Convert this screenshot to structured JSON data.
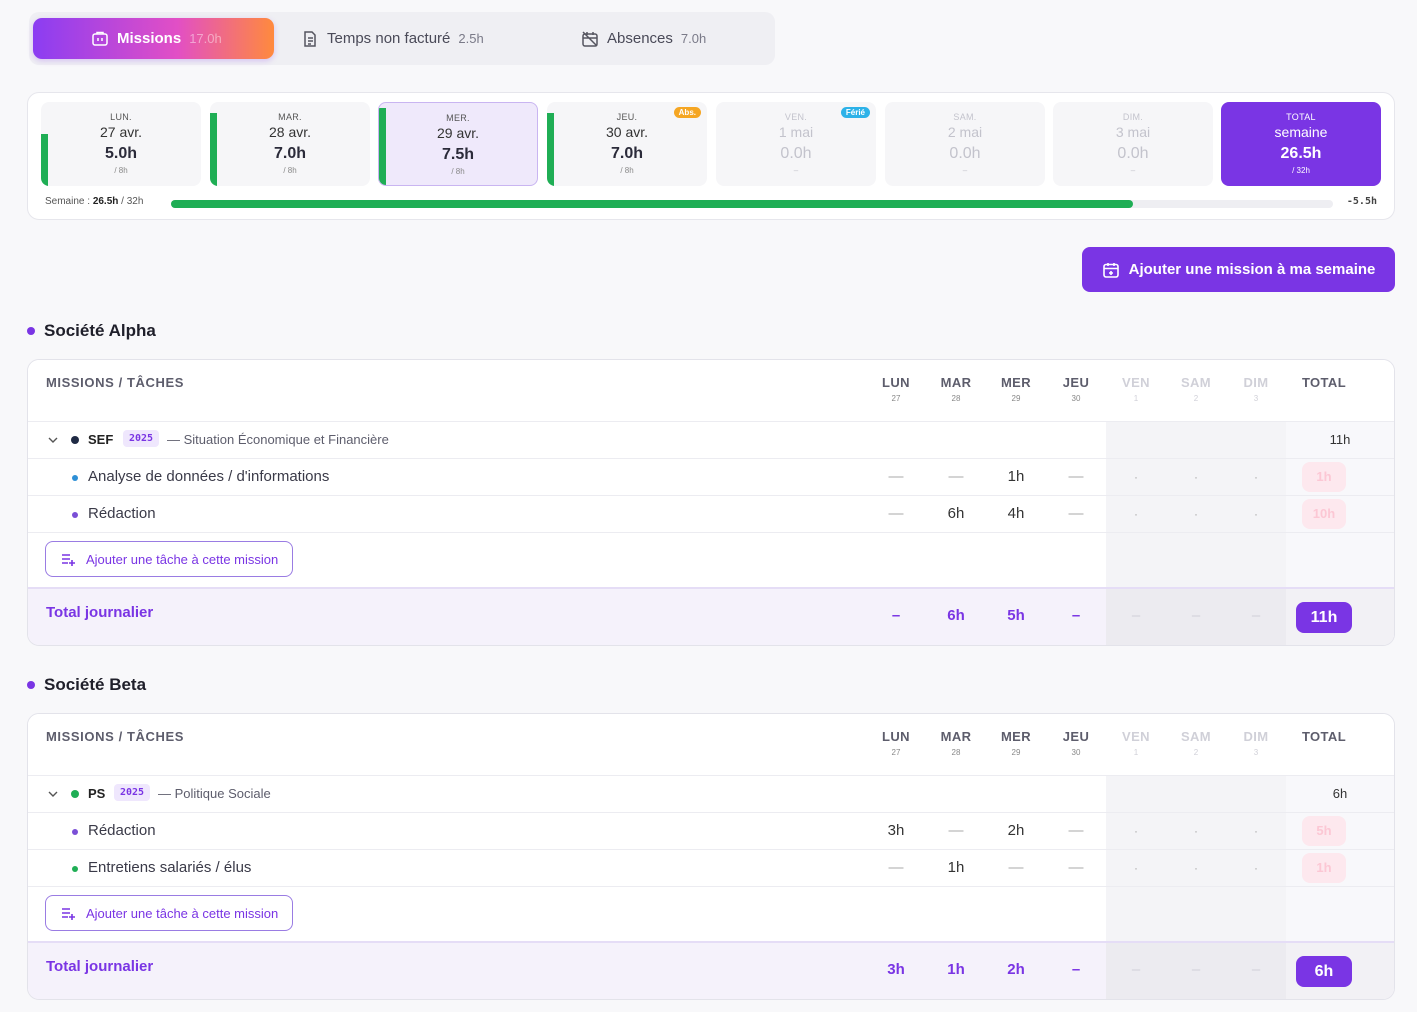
{
  "tabs": [
    {
      "label": "Missions",
      "hours": "17.0h",
      "icon": "briefcase-icon",
      "active": true
    },
    {
      "label": "Temps non facturé",
      "hours": "2.5h",
      "icon": "document-icon",
      "active": false
    },
    {
      "label": "Absences",
      "hours": "7.0h",
      "icon": "calendar-off-icon",
      "active": false
    }
  ],
  "week": {
    "days": [
      {
        "name": "LUN.",
        "date": "27 avr.",
        "hours": "5.0h",
        "target": "/ 8h",
        "badge": "",
        "fill": 0.625
      },
      {
        "name": "MAR.",
        "date": "28 avr.",
        "hours": "7.0h",
        "target": "/ 8h",
        "badge": "",
        "fill": 0.875
      },
      {
        "name": "MER.",
        "date": "29 avr.",
        "hours": "7.5h",
        "target": "/ 8h",
        "badge": "",
        "fill": 0.9375
      },
      {
        "name": "JEU.",
        "date": "30 avr.",
        "hours": "7.0h",
        "target": "/ 8h",
        "badge": "Abs.",
        "fill": 0.875
      },
      {
        "name": "VEN.",
        "date": "1 mai",
        "hours": "0.0h",
        "target": "–",
        "badge": "Férié",
        "fill": 0
      },
      {
        "name": "SAM.",
        "date": "2 mai",
        "hours": "0.0h",
        "target": "–",
        "badge": "",
        "fill": 0
      },
      {
        "name": "DIM.",
        "date": "3 mai",
        "hours": "0.0h",
        "target": "–",
        "badge": "",
        "fill": 0
      }
    ],
    "total": {
      "name": "TOTAL",
      "label": "semaine",
      "hours": "26.5h",
      "target": "/ 32h"
    },
    "summary_label": "Semaine :",
    "summary_hours": "26.5h",
    "summary_sep": "/",
    "summary_target": "32h",
    "progress": 0.828,
    "difference": "-5.5h"
  },
  "add_mission_label": "Ajouter une mission à ma semaine",
  "columns": {
    "header": "MISSIONS / TÂCHES",
    "days": [
      {
        "name": "LUN",
        "num": "27"
      },
      {
        "name": "MAR",
        "num": "28"
      },
      {
        "name": "MER",
        "num": "29"
      },
      {
        "name": "JEU",
        "num": "30"
      },
      {
        "name": "VEN",
        "num": "1"
      },
      {
        "name": "SAM",
        "num": "2"
      },
      {
        "name": "DIM",
        "num": "3"
      }
    ],
    "total": "TOTAL"
  },
  "companies": [
    {
      "name": "Société Alpha",
      "mission": {
        "code": "SEF",
        "year": "2025",
        "name": "— Situation Économique et Financière",
        "total": "11h",
        "color": "#1f2a44"
      },
      "tasks": [
        {
          "name": "Analyse de données / d'informations",
          "color": "#2d8fd6",
          "values": [
            "—",
            "—",
            "1h",
            "—",
            "·",
            "·",
            "·"
          ],
          "total": "1h"
        },
        {
          "name": "Rédaction",
          "color": "#7a4fd6",
          "values": [
            "—",
            "6h",
            "4h",
            "—",
            "·",
            "·",
            "·"
          ],
          "total": "10h"
        }
      ],
      "add_task_label": "Ajouter une tâche à cette mission",
      "daily_total_label": "Total journalier",
      "daily_totals": [
        "–",
        "6h",
        "5h",
        "–",
        "–",
        "–",
        "–"
      ],
      "grand_total": "11h"
    },
    {
      "name": "Société Beta",
      "mission": {
        "code": "PS",
        "year": "2025",
        "name": "— Politique Sociale",
        "total": "6h",
        "color": "#1fae55"
      },
      "tasks": [
        {
          "name": "Rédaction",
          "color": "#7a4fd6",
          "values": [
            "3h",
            "—",
            "2h",
            "—",
            "·",
            "·",
            "·"
          ],
          "total": "5h"
        },
        {
          "name": "Entretiens salariés / élus",
          "color": "#1fae55",
          "values": [
            "—",
            "1h",
            "—",
            "—",
            "·",
            "·",
            "·"
          ],
          "total": "1h"
        }
      ],
      "add_task_label": "Ajouter une tâche à cette mission",
      "daily_total_label": "Total journalier",
      "daily_totals": [
        "3h",
        "1h",
        "2h",
        "–",
        "–",
        "–",
        "–"
      ],
      "grand_total": "6h"
    }
  ],
  "colors": {
    "accent": "#7a35e4",
    "success": "#1fae55",
    "absence": "#f5a623",
    "holiday": "#2db2e8"
  }
}
